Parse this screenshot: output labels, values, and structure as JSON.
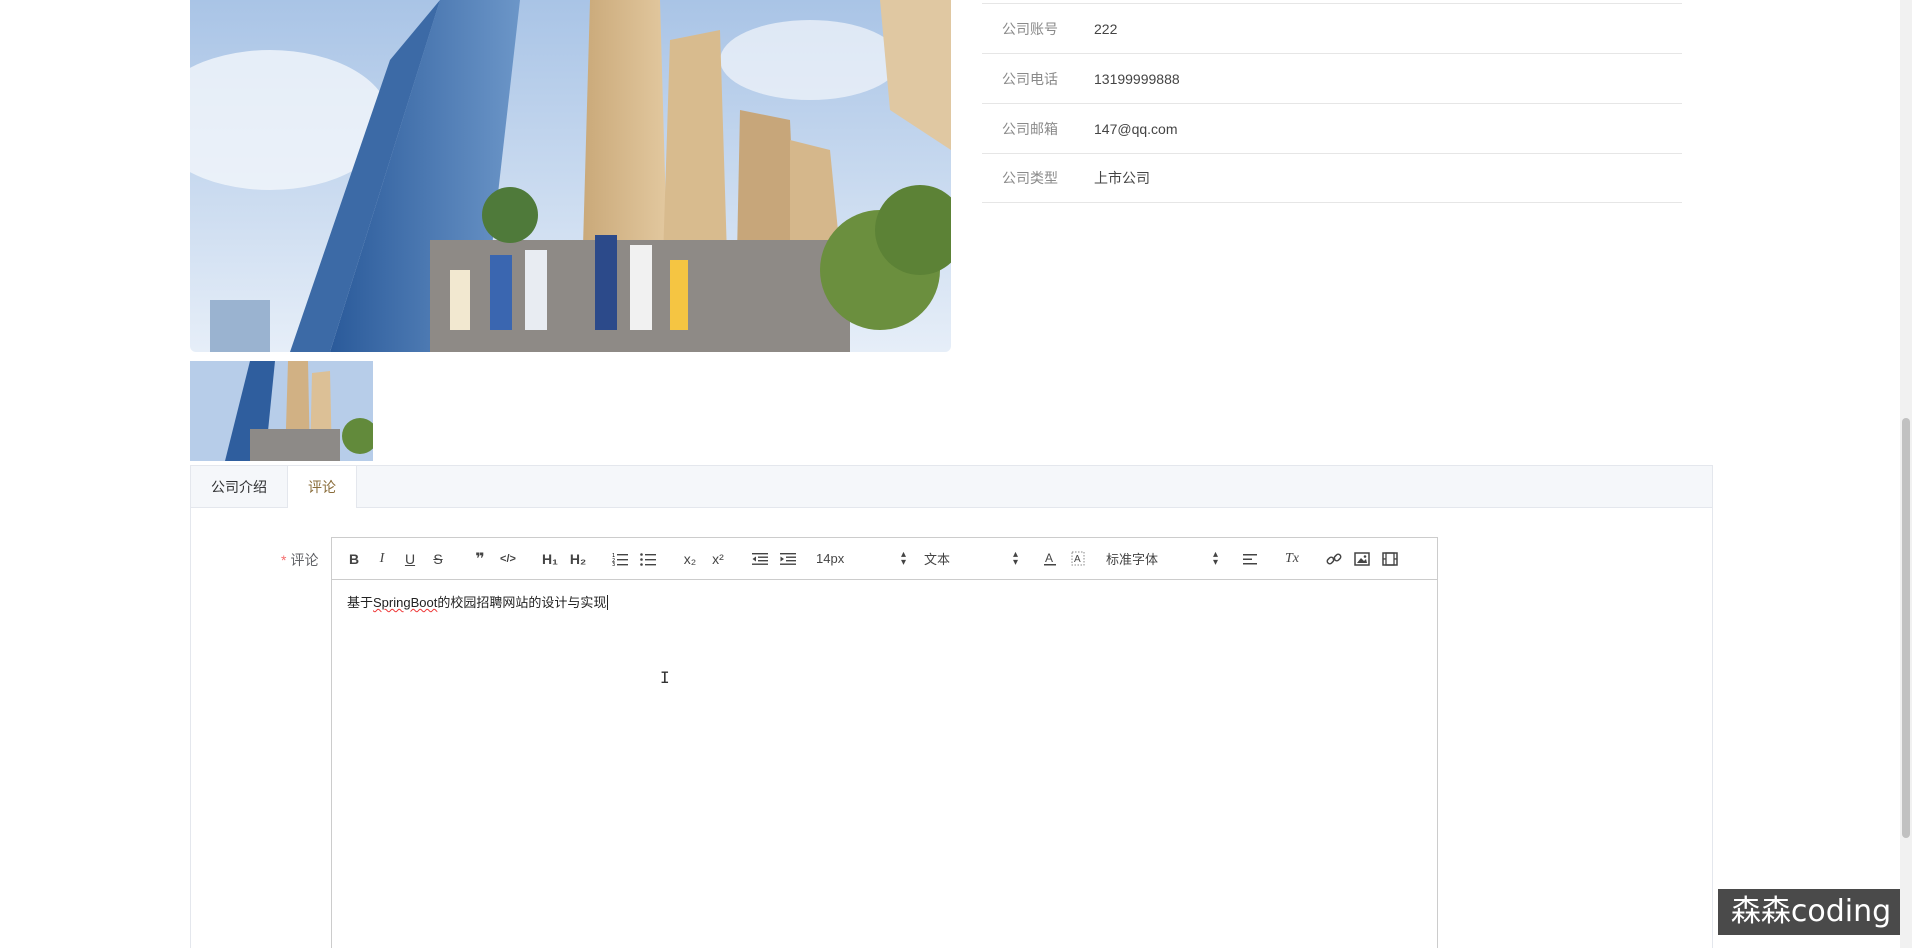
{
  "info": [
    {
      "label": "公司账号",
      "value": "222"
    },
    {
      "label": "公司电话",
      "value": "13199999888"
    },
    {
      "label": "公司邮箱",
      "value": "147@qq.com"
    },
    {
      "label": "公司类型",
      "value": "上市公司"
    }
  ],
  "tabs": [
    {
      "label": "公司介绍"
    },
    {
      "label": "评论"
    }
  ],
  "form": {
    "required_mark": "*",
    "comment_label": "评论"
  },
  "editor": {
    "toolbar": {
      "bold": "B",
      "italic": "I",
      "underline": "U",
      "strike": "S",
      "blockquote": "❞",
      "code": "</>",
      "h1": "H₁",
      "h2": "H₂",
      "sub": "x₂",
      "sup": "x²",
      "size_value": "14px",
      "header_value": "文本",
      "font_value": "标准字体",
      "clean": "Tx"
    },
    "content_prefix": "基于",
    "content_spell": "SpringBoot",
    "content_suffix": "的校园招聘网站的设计与实现"
  },
  "watermark": "森森coding",
  "colors": {
    "tab_active": "#8a6d3b",
    "required": "#f56c6c"
  }
}
